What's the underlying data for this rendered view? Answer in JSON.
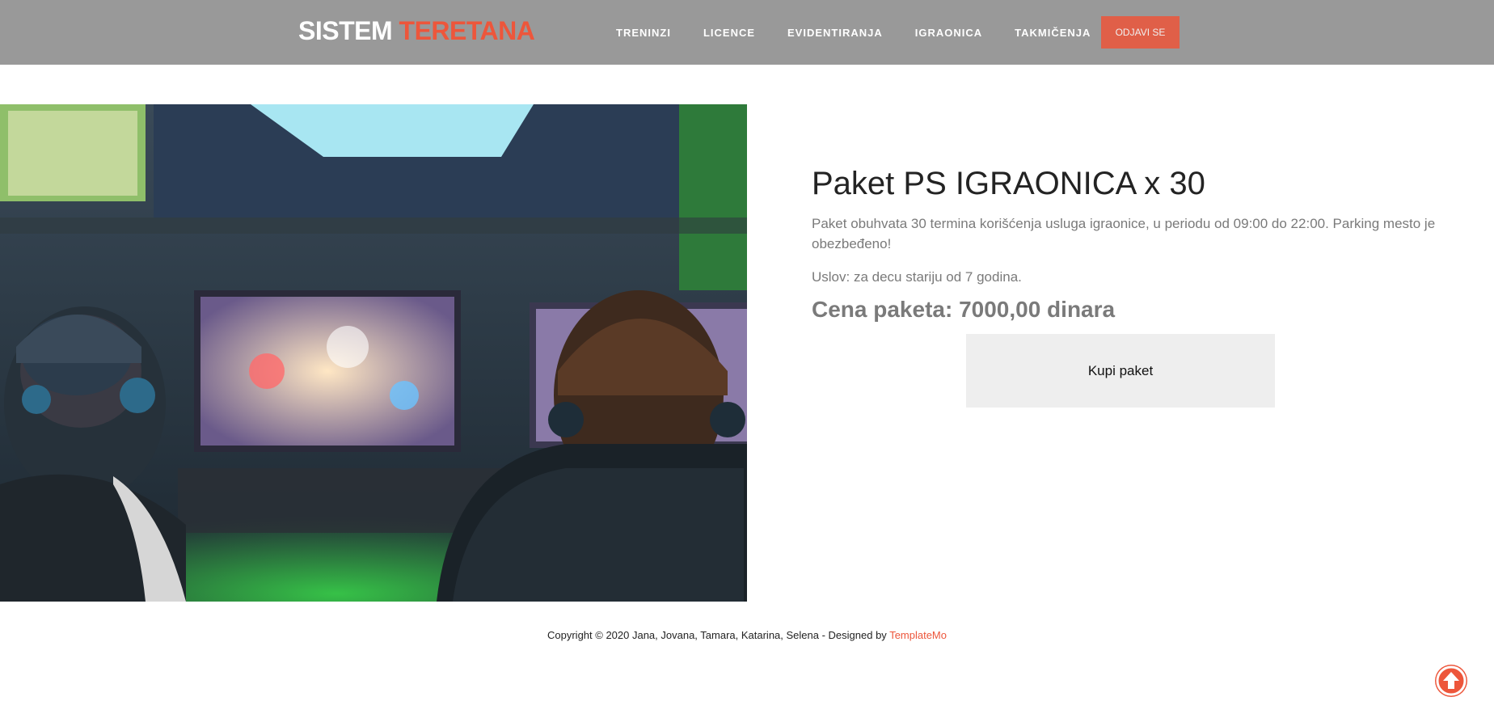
{
  "header": {
    "logo_part1": "SISTEM",
    "logo_part2": "TERETANA",
    "nav": [
      "TRENINZI",
      "LICENCE",
      "EVIDENTIRANJA",
      "IGRAONICA",
      "TAKMIČENJA"
    ],
    "logout_label": "ODJAVI SE"
  },
  "package": {
    "title": "Paket PS IGRAONICA x 30",
    "description": "Paket obuhvata 30 termina korišćenja usluga igraonice, u periodu od 09:00 do 22:00. Parking mesto je obezbeđeno!",
    "condition": "Uslov: za decu stariju od 7 godina.",
    "price": "Cena paketa: 7000,00 dinara",
    "buy_label": "Kupi paket"
  },
  "footer": {
    "copyright": "Copyright © 2020 Jana, Jovana, Tamara, Katarina, Selena - Designed by ",
    "credit_link": "TemplateMo"
  },
  "icons": {
    "scroll_top": "arrow-up-circle-icon"
  },
  "colors": {
    "accent": "#ed563b",
    "navbar": "#999999",
    "button_bg": "#eeeeee"
  }
}
